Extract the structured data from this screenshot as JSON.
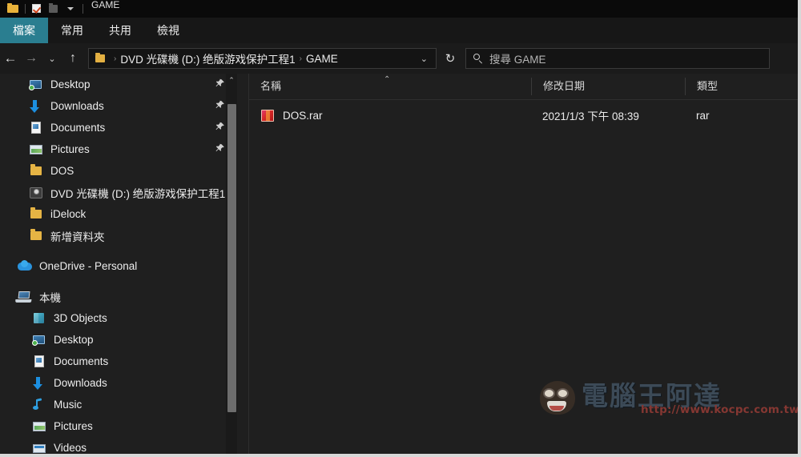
{
  "window": {
    "title": "GAME",
    "quick_access": [
      {
        "name": "folder-icon",
        "label": "folder"
      },
      {
        "name": "properties-icon",
        "label": "properties"
      },
      {
        "name": "new-folder-icon",
        "label": "new folder"
      },
      {
        "name": "customize-caret-icon",
        "label": "customize"
      }
    ]
  },
  "ribbon": {
    "tabs": [
      {
        "label": "檔案",
        "active": true
      },
      {
        "label": "常用",
        "active": false
      },
      {
        "label": "共用",
        "active": false
      },
      {
        "label": "檢視",
        "active": false
      }
    ]
  },
  "nav": {
    "back": "←",
    "forward": "→",
    "recent": "⌄",
    "up": "↑",
    "refresh": "↻",
    "dropdown": "⌄",
    "breadcrumbs": [
      "DVD 光碟機 (D:) 绝版游戏保护工程1",
      "GAME"
    ],
    "separator": "›"
  },
  "search": {
    "placeholder": "搜尋 GAME",
    "icon": "search-icon"
  },
  "sidebar": {
    "quick_access_items": [
      {
        "label": "Desktop",
        "icon": "desktop-icon",
        "pinned": true,
        "indent": 1
      },
      {
        "label": "Downloads",
        "icon": "download-icon",
        "pinned": true,
        "indent": 1
      },
      {
        "label": "Documents",
        "icon": "document-icon",
        "pinned": true,
        "indent": 1
      },
      {
        "label": "Pictures",
        "icon": "pictures-icon",
        "pinned": true,
        "indent": 1
      },
      {
        "label": "DOS",
        "icon": "folder-icon",
        "pinned": false,
        "indent": 1
      },
      {
        "label": "DVD 光碟機 (D:) 绝版游戏保护工程1",
        "icon": "dvd-drive-icon",
        "pinned": false,
        "indent": 1
      },
      {
        "label": "iDelock",
        "icon": "folder-icon",
        "pinned": false,
        "indent": 1
      },
      {
        "label": "新增資料夾",
        "icon": "folder-icon",
        "pinned": false,
        "indent": 1
      }
    ],
    "onedrive": {
      "label": "OneDrive - Personal",
      "icon": "onedrive-icon"
    },
    "this_pc": {
      "label": "本機",
      "icon": "this-pc-icon"
    },
    "this_pc_items": [
      {
        "label": "3D Objects",
        "icon": "3d-objects-icon"
      },
      {
        "label": "Desktop",
        "icon": "desktop-icon"
      },
      {
        "label": "Documents",
        "icon": "document-icon"
      },
      {
        "label": "Downloads",
        "icon": "download-icon"
      },
      {
        "label": "Music",
        "icon": "music-icon"
      },
      {
        "label": "Pictures",
        "icon": "pictures-icon"
      },
      {
        "label": "Videos",
        "icon": "video-icon"
      }
    ],
    "pin_glyph": "📌",
    "scroll_up_glyph": "⌃"
  },
  "file_list": {
    "columns": [
      {
        "label": "名稱",
        "sorted": "asc"
      },
      {
        "label": "修改日期",
        "sorted": ""
      },
      {
        "label": "類型",
        "sorted": ""
      }
    ],
    "sort_caret": "⌃",
    "rows": [
      {
        "name": "DOS.rar",
        "date": "2021/1/3 下午 08:39",
        "type": "rar",
        "icon": "rar-archive-icon"
      }
    ]
  },
  "watermark": {
    "title": "電腦王阿達",
    "url": "http://www.kocpc.com.tw"
  }
}
